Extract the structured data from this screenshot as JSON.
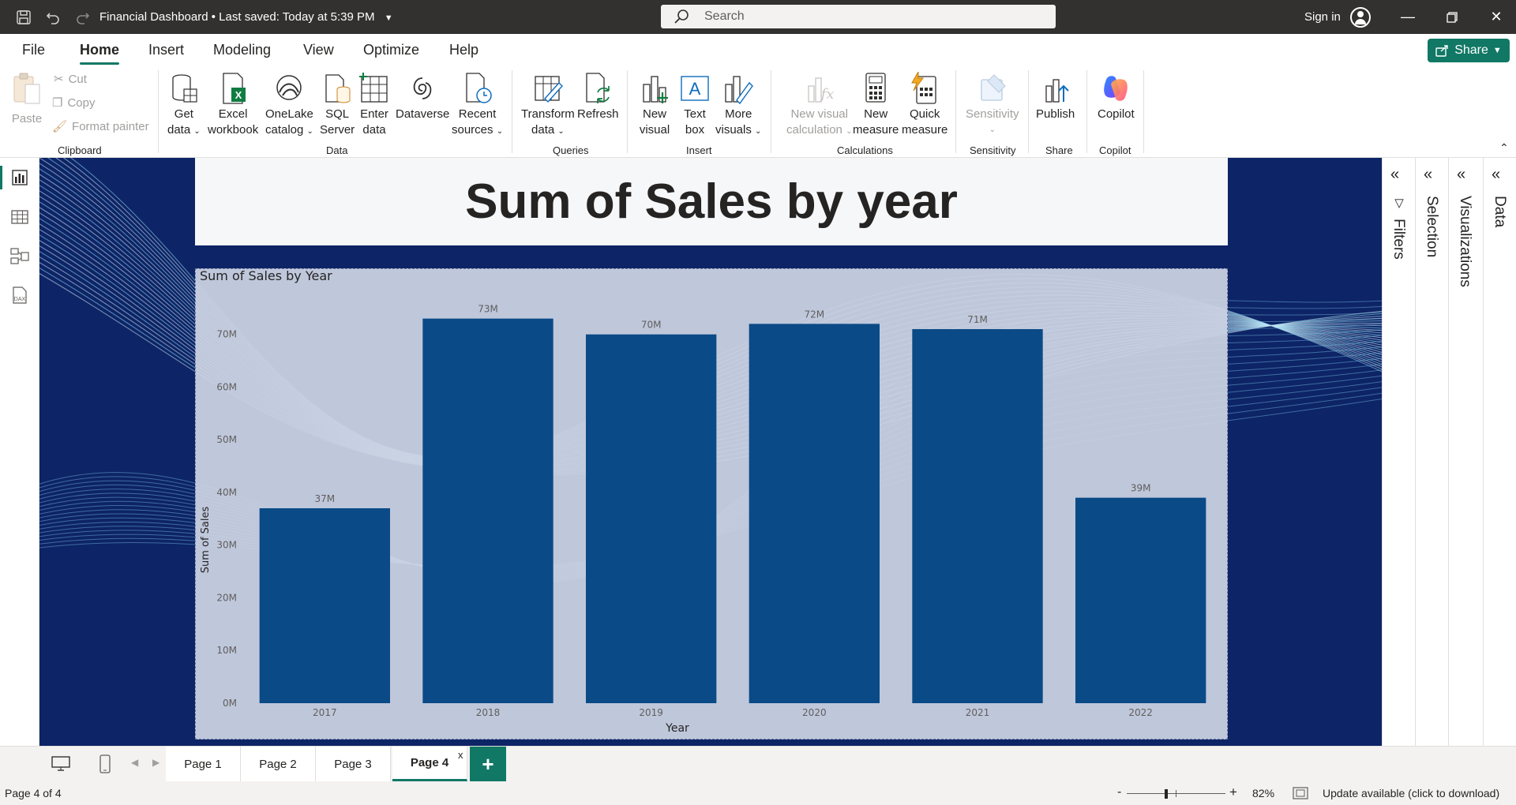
{
  "titlebar": {
    "doc_title": "Financial Dashboard",
    "saved_status": "Last saved: Today at 5:39 PM",
    "search_placeholder": "Search",
    "signin": "Sign in"
  },
  "menu": {
    "file": "File",
    "home": "Home",
    "insert": "Insert",
    "modeling": "Modeling",
    "view": "View",
    "optimize": "Optimize",
    "help": "Help",
    "share": "Share"
  },
  "ribbon": {
    "clipboard": {
      "paste": "Paste",
      "cut": "Cut",
      "copy": "Copy",
      "format_painter": "Format painter",
      "label": "Clipboard"
    },
    "data": {
      "get_data": [
        "Get",
        "data"
      ],
      "excel": [
        "Excel",
        "workbook"
      ],
      "onelake": [
        "OneLake",
        "catalog"
      ],
      "sql": [
        "SQL",
        "Server"
      ],
      "enter": [
        "Enter",
        "data"
      ],
      "dataverse": "Dataverse",
      "recent": [
        "Recent",
        "sources"
      ],
      "label": "Data"
    },
    "queries": {
      "transform": [
        "Transform",
        "data"
      ],
      "refresh": "Refresh",
      "label": "Queries"
    },
    "insert": {
      "new_visual": [
        "New",
        "visual"
      ],
      "text_box": [
        "Text",
        "box"
      ],
      "more_visuals": [
        "More",
        "visuals"
      ],
      "label": "Insert"
    },
    "calculations": {
      "new_visual_calc": [
        "New visual",
        "calculation"
      ],
      "new_measure": [
        "New",
        "measure"
      ],
      "quick_measure": [
        "Quick",
        "measure"
      ],
      "label": "Calculations"
    },
    "sensitivity": {
      "button": "Sensitivity",
      "label": "Sensitivity"
    },
    "share": {
      "publish": "Publish",
      "label": "Share"
    },
    "copilot": {
      "button": "Copilot",
      "label": "Copilot"
    }
  },
  "panes": {
    "filters": "Filters",
    "selection": "Selection",
    "visualizations": "Visualizations",
    "data": "Data"
  },
  "report": {
    "title_card": "Sum of Sales by year"
  },
  "chart_data": {
    "type": "bar",
    "title": "Sum of Sales by Year",
    "xlabel": "Year",
    "ylabel": "Sum of Sales",
    "categories": [
      "2017",
      "2018",
      "2019",
      "2020",
      "2021",
      "2022"
    ],
    "values": [
      37,
      73,
      70,
      72,
      71,
      39
    ],
    "data_labels": [
      "37M",
      "73M",
      "70M",
      "72M",
      "71M",
      "39M"
    ],
    "unit": "M",
    "yticks": [
      "0M",
      "10M",
      "20M",
      "30M",
      "40M",
      "50M",
      "60M",
      "70M"
    ],
    "ylim": [
      0,
      74
    ],
    "bar_color": "#0a4a86",
    "grid": false,
    "legend": false
  },
  "pages": {
    "tabs": [
      "Page 1",
      "Page 2",
      "Page 3",
      "Page 4"
    ],
    "active": "Page 4",
    "close_glyph": "x",
    "add": "+"
  },
  "status": {
    "page_info": "Page 4 of 4",
    "zoom_minus": "-",
    "zoom_plus": "+",
    "zoom": "82%",
    "zoom_level_percent": 82,
    "update": "Update available (click to download)"
  },
  "colors": {
    "accent": "#117865",
    "titlebar": "#323130",
    "page_background": "#0d2466",
    "bar": "#0a4a86"
  }
}
